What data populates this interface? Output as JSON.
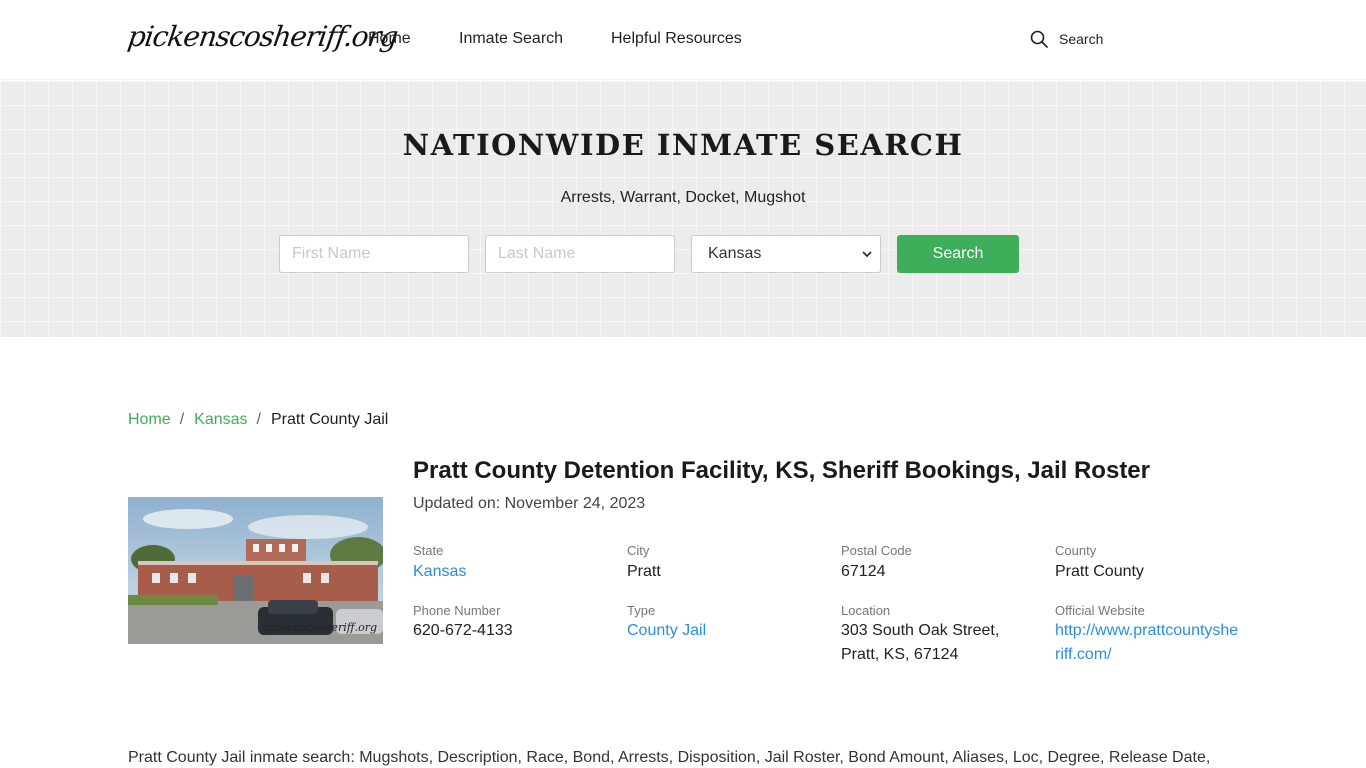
{
  "header": {
    "logo": "pickenscosheriff.org",
    "nav": [
      "Home",
      "Inmate Search",
      "Helpful Resources"
    ],
    "search_label": "Search"
  },
  "hero": {
    "title": "NATIONWIDE INMATE SEARCH",
    "subtitle": "Arrests, Warrant, Docket, Mugshot",
    "first_name_placeholder": "First Name",
    "last_name_placeholder": "Last Name",
    "state_selected": "Kansas",
    "search_button": "Search"
  },
  "breadcrumb": {
    "home": "Home",
    "state": "Kansas",
    "current": "Pratt County Jail"
  },
  "facility": {
    "photo_watermark": "pickenscosheriff.org",
    "title": "Pratt County Detention Facility, KS, Sheriff Bookings, Jail Roster",
    "updated": "Updated on: November 24, 2023",
    "fields": {
      "state_label": "State",
      "state_value": "Kansas",
      "city_label": "City",
      "city_value": "Pratt",
      "postal_label": "Postal Code",
      "postal_value": "67124",
      "county_label": "County",
      "county_value": "Pratt County",
      "phone_label": "Phone Number",
      "phone_value": "620-672-4133",
      "type_label": "Type",
      "type_value": "County Jail",
      "location_label": "Location",
      "location_line1": "303 South Oak Street,",
      "location_line2": "Pratt, KS, 67124",
      "website_label": "Official Website",
      "website_line1": "http://www.prattcountyshe",
      "website_line2": "riff.com/"
    }
  },
  "description": "Pratt County Jail inmate search: Mugshots, Description, Race, Bond, Arrests, Disposition, Jail Roster, Bond Amount, Aliases, Loc, Degree, Release Date,"
}
